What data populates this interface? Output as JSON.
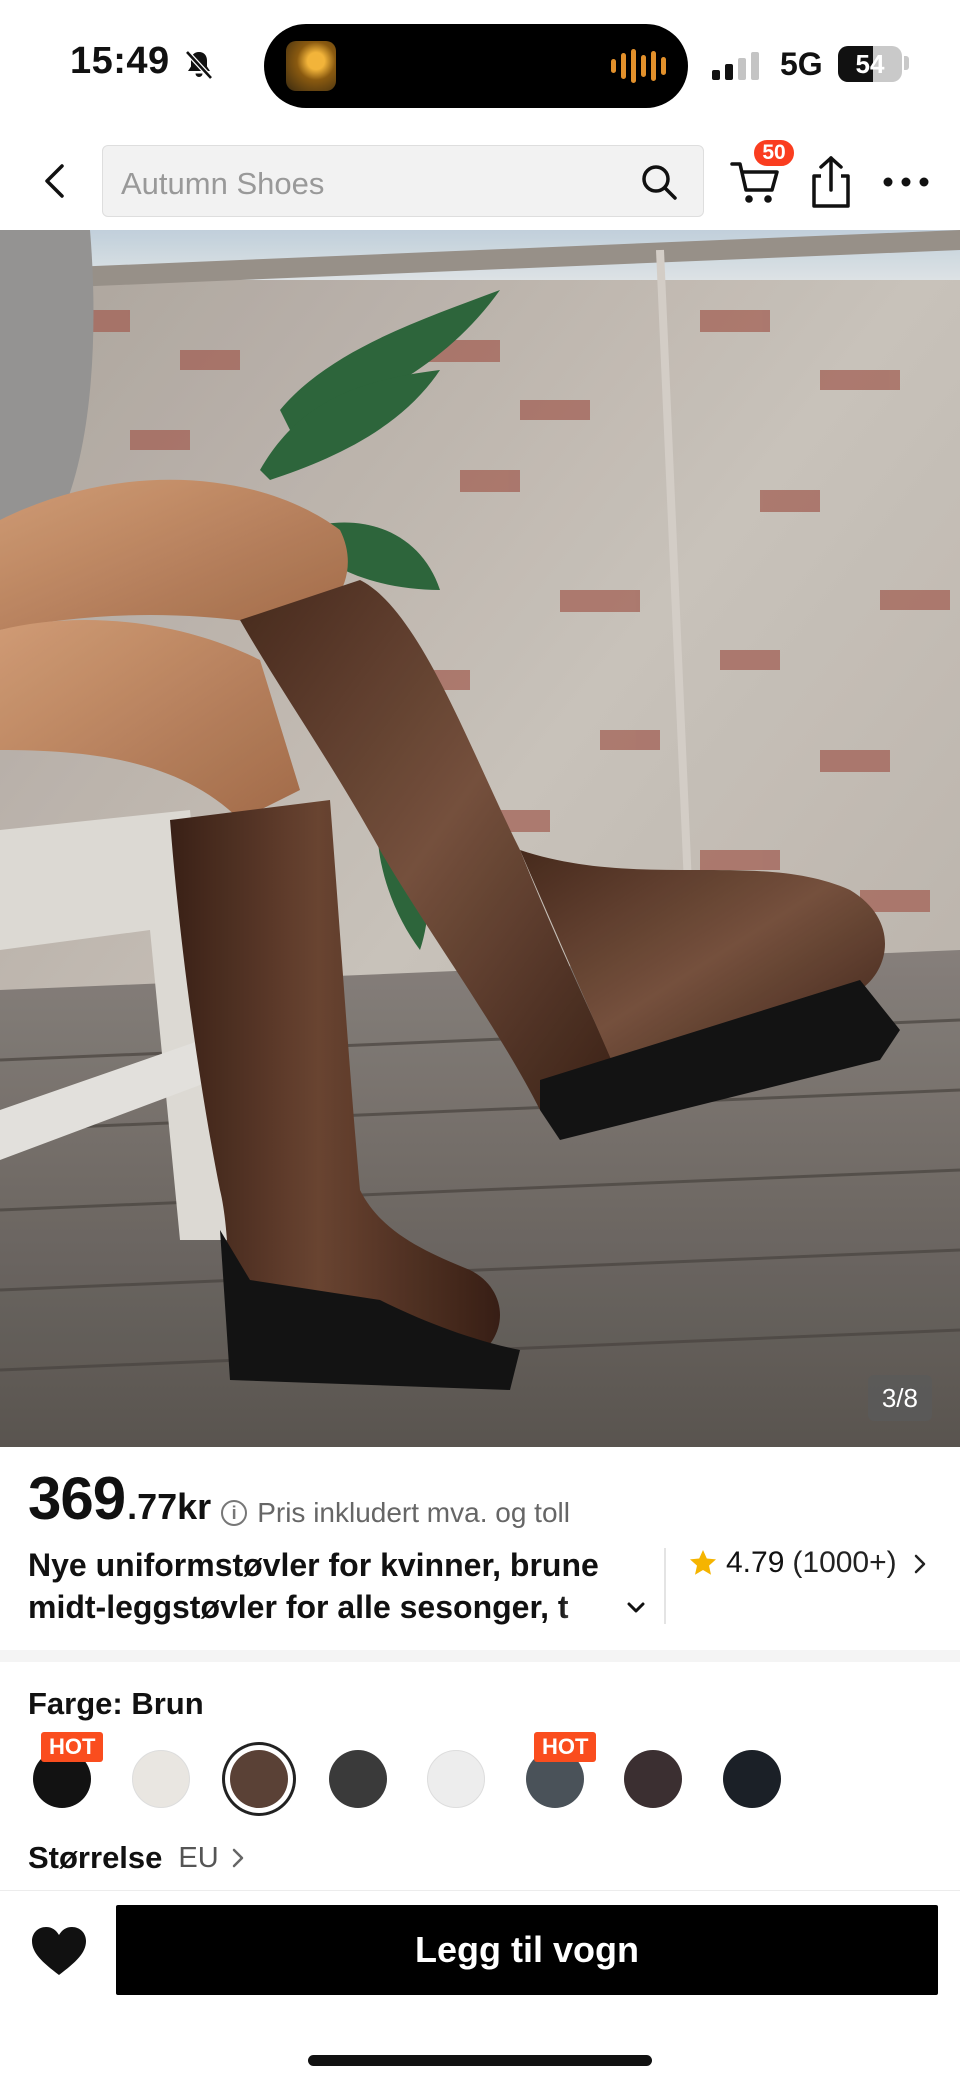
{
  "status_bar": {
    "time": "15:49",
    "network": "5G",
    "battery": "54",
    "battery_level": 0.54,
    "icons": [
      "bell-slash-icon",
      "signal-icon",
      "battery-icon"
    ]
  },
  "nav": {
    "search_placeholder": "Autumn Shoes",
    "cart_count": "50",
    "icons": [
      "chevron-left-icon",
      "search-icon",
      "cart-icon",
      "share-icon",
      "more-icon"
    ]
  },
  "gallery": {
    "counter": "3/8",
    "current_index": 3,
    "total": 8
  },
  "product": {
    "price_int": "369",
    "price_dec": ".77kr",
    "price_note": "Pris inkludert mva. og toll",
    "title": "Nye uniformstøvler for kvinner, brune midt-leggstøvler for alle sesonger, t",
    "rating": "4.79",
    "rating_count": "(1000+)"
  },
  "color": {
    "label": "Farge: Brun",
    "hot_label": "HOT",
    "swatches": [
      {
        "name": "black",
        "color": "#121212",
        "hot": true
      },
      {
        "name": "off-white",
        "color": "#e9e6e1",
        "hot": false
      },
      {
        "name": "brown",
        "color": "#5a4136",
        "hot": false,
        "selected": true
      },
      {
        "name": "dark-grey",
        "color": "#3a3a3a",
        "hot": false
      },
      {
        "name": "white",
        "color": "#ededed",
        "hot": false
      },
      {
        "name": "slate",
        "color": "#4a5259",
        "hot": true
      },
      {
        "name": "dark-brown",
        "color": "#3b2f31",
        "hot": false
      },
      {
        "name": "navy",
        "color": "#1b2027",
        "hot": false
      }
    ]
  },
  "size": {
    "label": "Størrelse",
    "unit": "EU"
  },
  "bottom_bar": {
    "add_to_cart": "Legg til vogn"
  },
  "colors": {
    "accent": "#fa3d1f",
    "button": "#000000",
    "star": "#f5b400"
  }
}
